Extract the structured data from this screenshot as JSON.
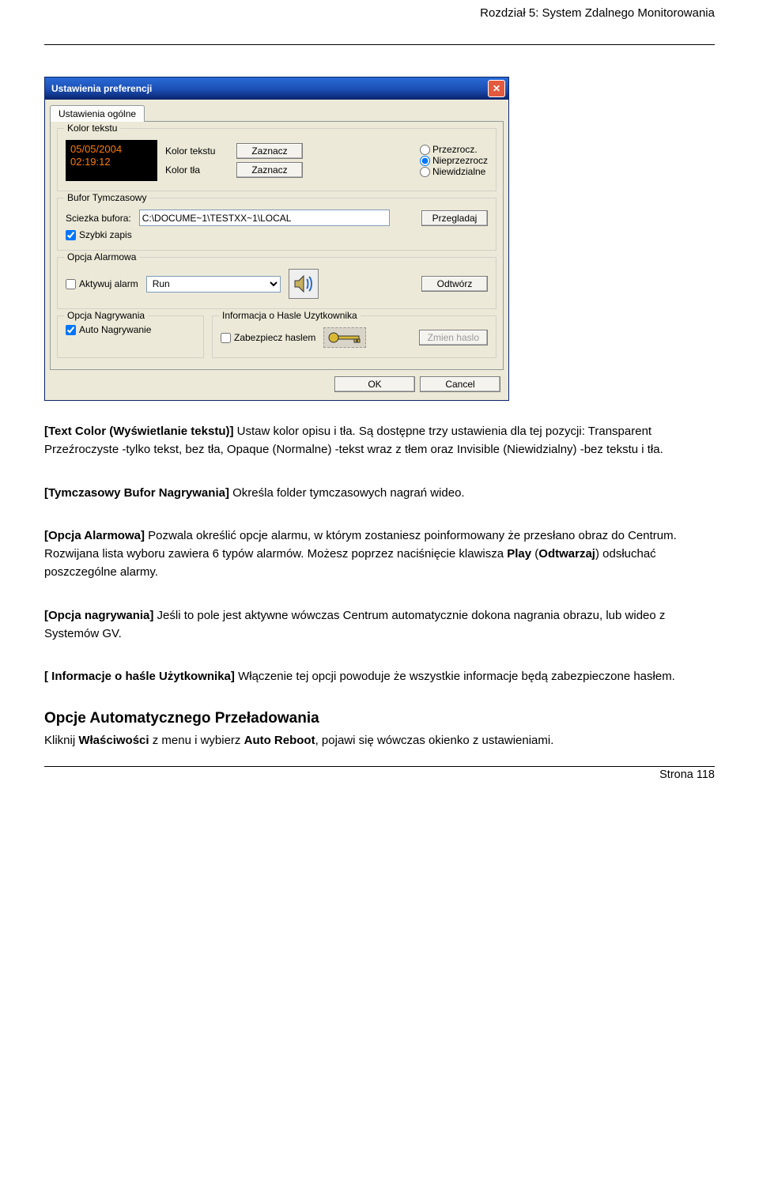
{
  "header": {
    "chapter": "Rozdział 5: System Zdalnego Monitorowania"
  },
  "dialog": {
    "title": "Ustawienia preferencji",
    "tab": "Ustawienia ogólne",
    "groups": {
      "textcolor": {
        "title": "Kolor tekstu",
        "preview_line1": "05/05/2004",
        "preview_line2": "02:19:12",
        "label_text": "Kolor tekstu",
        "label_bg": "Kolor tła",
        "btn_pick": "Zaznacz",
        "radio1": "Przezrocz.",
        "radio2": "Nieprzezrocz",
        "radio3": "Niewidzialne"
      },
      "buffer": {
        "title": "Bufor Tymczasowy",
        "path_label": "Sciezka bufora:",
        "path_value": "C:\\DOCUME~1\\TESTXX~1\\LOCAL",
        "browse": "Przegladaj",
        "fast": "Szybki zapis"
      },
      "alarm": {
        "title": "Opcja Alarmowa",
        "activate": "Aktywuj alarm",
        "select_value": "Run",
        "play": "Odtwórz"
      },
      "record": {
        "title": "Opcja Nagrywania",
        "auto": "Auto Nagrywanie"
      },
      "userpass": {
        "title": "Informacja o Hasle Uzytkownika",
        "protect": "Zabezpiecz haslem",
        "change": "Zmien haslo"
      }
    },
    "ok": "OK",
    "cancel": "Cancel"
  },
  "body": {
    "p1_bold": "[Text Color (Wyświetlanie tekstu)]",
    "p1_rest": "   Ustaw kolor opisu i tła. Są dostępne trzy ustawienia dla tej pozycji: Transparent Przeźroczyste -tylko tekst, bez tła, Opaque (Normalne) -tekst wraz z tłem oraz Invisible (Niewidzialny) -bez tekstu i tła.",
    "p2_bold": "[Tymczasowy Bufor Nagrywania]",
    "p2_rest": "   Określa folder tymczasowych nagrań wideo.",
    "p3_bold": "[Opcja Alarmowa]",
    "p3_rest_a": "   Pozwala określić opcje alarmu, w którym zostaniesz poinformowany że przesłano obraz do Centrum. Rozwijana lista wyboru zawiera 6 typów alarmów. Możesz poprzez naciśnięcie klawisza ",
    "p3_bold2": "Play",
    "p3_rest_b": " (",
    "p3_bold3": "Odtwarzaj",
    "p3_rest_c": ") odsłuchać poszczególne alarmy.",
    "p4_bold": "[Opcja nagrywania]",
    "p4_rest": "   Jeśli to pole jest aktywne wówczas Centrum automatycznie dokona nagrania obrazu, lub wideo z Systemów GV.",
    "p5_bold": "[ Informacje o haśle Użytkownika]",
    "p5_rest": "   Włączenie tej opcji powoduje że wszystkie informacje będą zabezpieczone hasłem.",
    "h3": "Opcje Automatycznego Przeładowania",
    "p6_a": "Kliknij ",
    "p6_bold1": "Właściwości",
    "p6_b": " z menu i wybierz ",
    "p6_bold2": "Auto Reboot",
    "p6_c": ", pojawi się wówczas okienko z ustawieniami."
  },
  "footer": {
    "page": "Strona 118"
  }
}
